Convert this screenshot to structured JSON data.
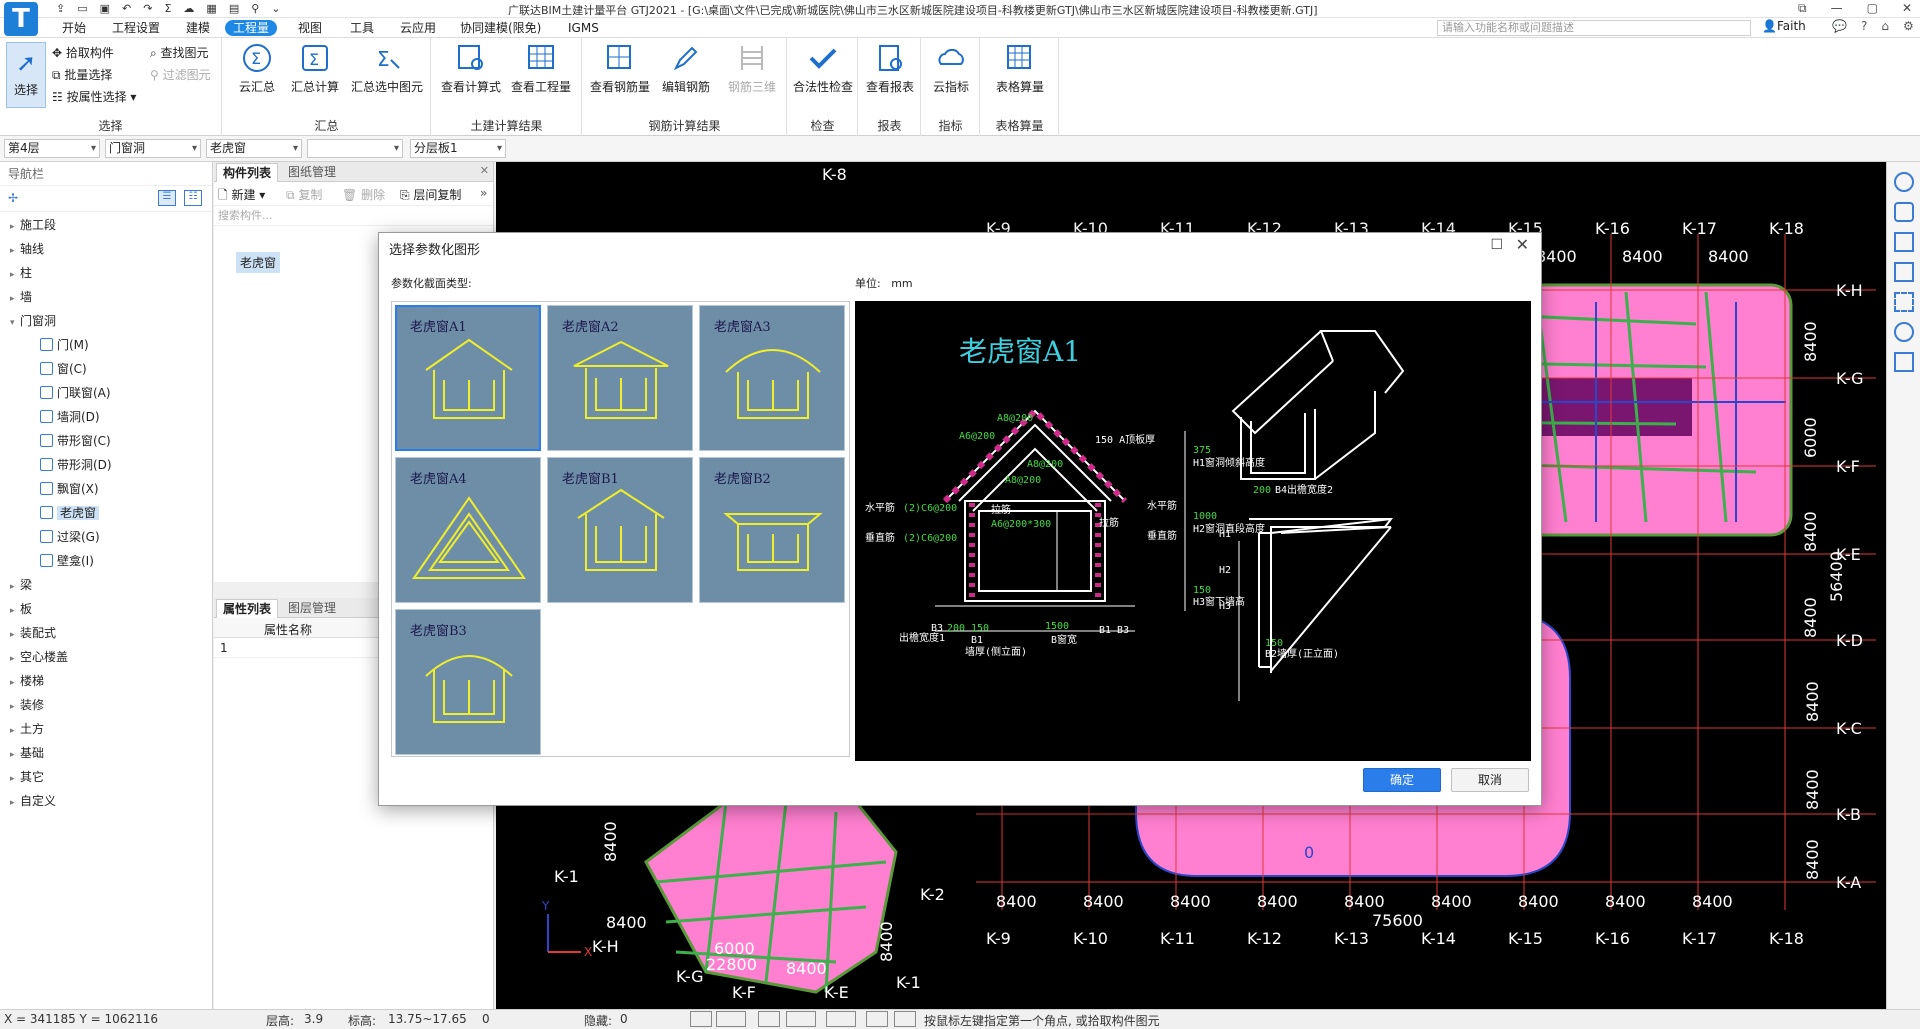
{
  "app": {
    "title": "广联达BIM土建计量平台 GTJ2021 - [G:\\桌面\\文件\\已完成\\新城医院\\佛山市三水区新城医院建设项目-科教楼更新GTJ\\佛山市三水区新城医院建设项目-科教楼更新.GTJ]",
    "search_placeholder": "请输入功能名称或问题描述",
    "user": "Faith",
    "accent": "#1e88e5"
  },
  "menu": [
    "开始",
    "工程设置",
    "建模",
    "工程量",
    "视图",
    "工具",
    "云应用",
    "协同建模(限免)",
    "IGMS"
  ],
  "menu_active": "工程量",
  "ribbon": {
    "select_group": {
      "select": "选择",
      "pick": "拾取构件",
      "batch": "批量选择",
      "by_attr": "按属性选择",
      "find": "查找图元",
      "filter": "过滤图元",
      "label": "选择"
    },
    "summary_group": {
      "cloud": "云汇总",
      "total": "汇总计算",
      "selected": "汇总选中图元",
      "label": "汇总"
    },
    "civil_group": {
      "formula": "查看计算式",
      "quantity": "查看工程量",
      "label": "土建计算结果"
    },
    "rebar_group": {
      "view": "查看钢筋量",
      "edit": "编辑钢筋",
      "three_d": "钢筋三维",
      "label": "钢筋计算结果"
    },
    "check_group": {
      "check": "合法性检查",
      "label": "检查"
    },
    "report_group": {
      "view": "查看报表",
      "label": "报表"
    },
    "index_group": {
      "cloud": "云指标",
      "label": "指标"
    },
    "table_group": {
      "table": "表格算量",
      "label": "表格算量"
    }
  },
  "props": {
    "floor": "第4层",
    "category": "门窗洞",
    "subtype": "老虎窗",
    "blank": "",
    "layer": "分层板1"
  },
  "nav": {
    "header": "导航栏",
    "items": [
      {
        "label": "施工段",
        "level": 0,
        "icon": "collapsed"
      },
      {
        "label": "轴线",
        "level": 0,
        "icon": "collapsed"
      },
      {
        "label": "柱",
        "level": 0,
        "icon": "collapsed"
      },
      {
        "label": "墙",
        "level": 0,
        "icon": "collapsed"
      },
      {
        "label": "门窗洞",
        "level": 0,
        "icon": "expanded"
      },
      {
        "label": "门(M)",
        "level": 1
      },
      {
        "label": "窗(C)",
        "level": 1
      },
      {
        "label": "门联窗(A)",
        "level": 1
      },
      {
        "label": "墙洞(D)",
        "level": 1
      },
      {
        "label": "带形窗(C)",
        "level": 1
      },
      {
        "label": "带形洞(D)",
        "level": 1
      },
      {
        "label": "飘窗(X)",
        "level": 1
      },
      {
        "label": "老虎窗",
        "level": 1,
        "selected": true
      },
      {
        "label": "过梁(G)",
        "level": 1
      },
      {
        "label": "壁龛(I)",
        "level": 1
      },
      {
        "label": "梁",
        "level": 0,
        "icon": "collapsed"
      },
      {
        "label": "板",
        "level": 0,
        "icon": "collapsed"
      },
      {
        "label": "装配式",
        "level": 0,
        "icon": "collapsed"
      },
      {
        "label": "空心楼盖",
        "level": 0,
        "icon": "collapsed"
      },
      {
        "label": "楼梯",
        "level": 0,
        "icon": "collapsed"
      },
      {
        "label": "装修",
        "level": 0,
        "icon": "collapsed"
      },
      {
        "label": "土方",
        "level": 0,
        "icon": "collapsed"
      },
      {
        "label": "基础",
        "level": 0,
        "icon": "collapsed"
      },
      {
        "label": "其它",
        "level": 0,
        "icon": "collapsed"
      },
      {
        "label": "自定义",
        "level": 0,
        "icon": "collapsed"
      }
    ]
  },
  "component_panel": {
    "tab1": "构件列表",
    "tab2": "图纸管理",
    "new": "新建",
    "copy": "复制",
    "delete": "删除",
    "floor_copy": "层间复制",
    "search_placeholder": "搜索构件...",
    "item": "老虎窗"
  },
  "attr_panel": {
    "tab1": "属性列表",
    "tab2": "图层管理",
    "col": "属性名称",
    "row1": "1"
  },
  "dialog": {
    "title": "选择参数化图形",
    "type_label": "参数化截面类型:",
    "unit_label": "单位:",
    "unit": "mm",
    "shapes": [
      "老虎窗A1",
      "老虎窗A2",
      "老虎窗A3",
      "老虎窗A4",
      "老虎窗B1",
      "老虎窗B2",
      "老虎窗B3"
    ],
    "selected": "老虎窗A1",
    "preview_title": "老虎窗A1",
    "ok": "确定",
    "cancel": "取消",
    "drawing_labels": {
      "a8200_top": "A8@200",
      "a6200_l": "A6@200",
      "a8200_c": "A8@200",
      "a8200_m": "A8@200",
      "slab": "150 A顶板厚",
      "h1v": "375",
      "h1": "H1窗洞倾斜高度",
      "hbar": "水平筋",
      "hbar_val": "(2)C6@200",
      "vbar": "垂直筋",
      "vbar_val": "(2)C6@200",
      "tie": "拉筋",
      "tie_val": "A6@200*300",
      "tie2": "拉筋",
      "hbar_r": "水平筋",
      "vbar_r": "垂直筋",
      "h2v": "1000",
      "h2": "H2窗洞直段高度",
      "h3v": "150",
      "h3": "H3窗下墙高",
      "b3": "B3",
      "d200": "200",
      "d150": "150",
      "d1500": "1500",
      "b1b3": "B1 B3",
      "b1": "B1",
      "eave": "出檐宽度1",
      "wall": "墙厚(侧立面)",
      "bw": "B窗宽",
      "b4v": "200",
      "b4": "B4出檐宽度2",
      "H1": "H1",
      "H2": "H2",
      "H3": "H3",
      "b2v": "150",
      "b2": "B2墙厚(正立面)"
    }
  },
  "canvas": {
    "axis_top": [
      "K-8",
      "K-9",
      "K-10",
      "K-11",
      "K-12",
      "K-13",
      "K-14",
      "K-15",
      "K-16",
      "K-17",
      "K-18"
    ],
    "axis_right": [
      "K-H",
      "K-G",
      "K-F",
      "K-E",
      "K-D",
      "K-C",
      "K-B",
      "K-A"
    ],
    "dim_8400": "8400",
    "dim_6000": "6000",
    "dim_56400": "56400",
    "dim_75600": "75600",
    "dim_22800": "22800",
    "axis_bottom": [
      "K-9",
      "K-10",
      "K-11",
      "K-12",
      "K-13",
      "K-14",
      "K-15",
      "K-16",
      "K-17",
      "K-18"
    ],
    "lower_left_axes": [
      "K-1",
      "K-2",
      "K-H",
      "K-G",
      "K-F",
      "K-E",
      "K-1"
    ],
    "zero_label": "0",
    "axis_x": "X",
    "axis_y": "Y"
  },
  "status": {
    "coords": "X = 341185 Y = 1062116",
    "floor_height_label": "层高:",
    "floor_height": "3.9",
    "elevation_label": "标高:",
    "elevation": "13.75~17.65",
    "count": "0",
    "hidden_label": "隐藏:",
    "hidden": "0",
    "hint": "按鼠标左键指定第一个角点, 或拾取构件图元"
  }
}
